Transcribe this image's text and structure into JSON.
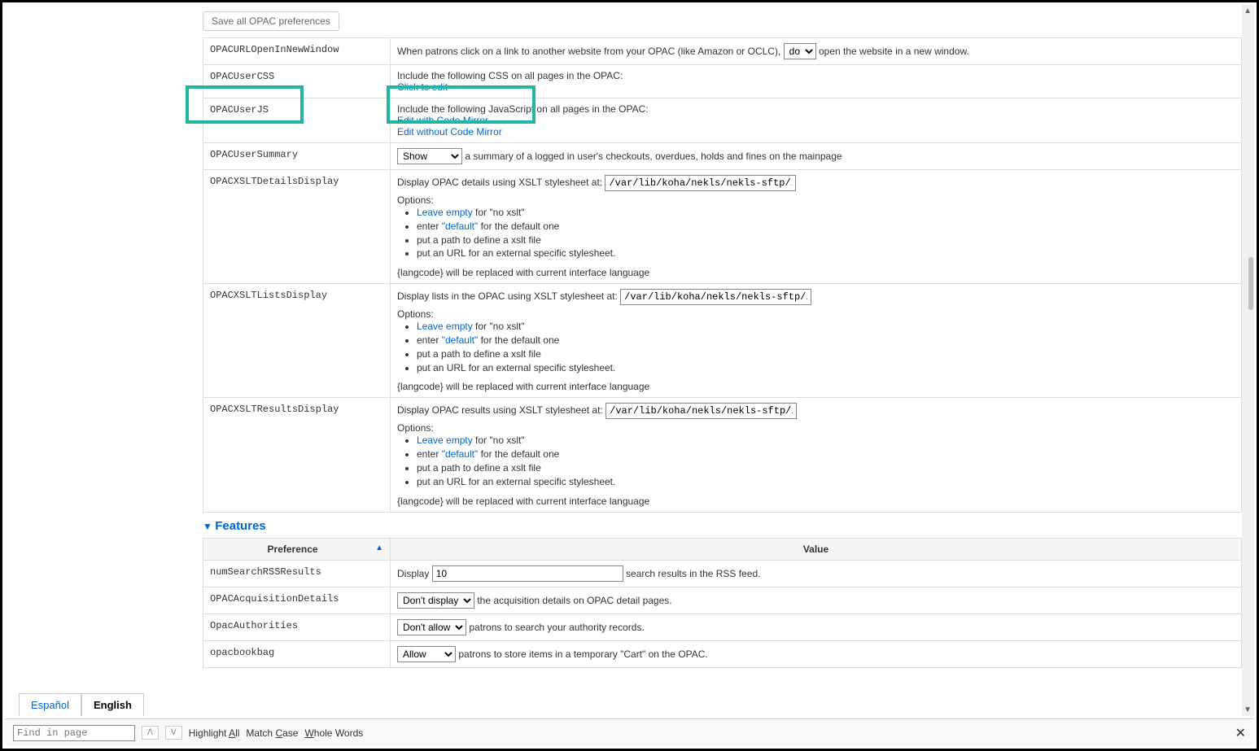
{
  "saveButton": "Save all OPAC preferences",
  "sectionFeatures": "Features",
  "headers": {
    "preference": "Preference",
    "value": "Value"
  },
  "rows": {
    "urlNewWindow": {
      "name": "OPACURLOpenInNewWindow",
      "pre": "When patrons click on a link to another website from your OPAC (like Amazon or OCLC),",
      "sel": "do",
      "post": "open the website in a new window."
    },
    "userCss": {
      "name": "OPACUserCSS",
      "text": "Include the following CSS on all pages in the OPAC:",
      "link": "Click to edit"
    },
    "userJs": {
      "name": "OPACUserJS",
      "text": "Include the following JavaScript on all pages in the OPAC:",
      "link1": "Edit with Code Mirror",
      "link2": "Edit without Code Mirror"
    },
    "userSummary": {
      "name": "OPACUserSummary",
      "sel": "Show",
      "post": "a summary of a logged in user's checkouts, overdues, holds and fines on the mainpage"
    },
    "xsltDetails": {
      "name": "OPACXSLTDetailsDisplay",
      "pre": "Display OPAC details using XSLT stylesheet at:",
      "val": "/var/lib/koha/nekls/nekls-sftp/i"
    },
    "xsltLists": {
      "name": "OPACXSLTListsDisplay",
      "pre": "Display lists in the OPAC using XSLT stylesheet at:",
      "val": "/var/lib/koha/nekls/nekls-sftp/i"
    },
    "xsltResults": {
      "name": "OPACXSLTResultsDisplay",
      "pre": "Display OPAC results using XSLT stylesheet at:",
      "val": "/var/lib/koha/nekls/nekls-sftp/i"
    },
    "numRss": {
      "name": "numSearchRSSResults",
      "pre": "Display",
      "val": "10",
      "post": "search results in the RSS feed."
    },
    "acqDetails": {
      "name": "OPACAcquisitionDetails",
      "sel": "Don't display",
      "post": "the acquisition details on OPAC detail pages."
    },
    "authorities": {
      "name": "OpacAuthorities",
      "sel": "Don't allow",
      "post": "patrons to search your authority records."
    },
    "bookbag": {
      "name": "opacbookbag",
      "sel": "Allow",
      "post": "patrons to store items in a temporary \"Cart\" on the OPAC."
    }
  },
  "xsltOptions": {
    "label": "Options:",
    "leaveEmpty": "Leave empty",
    "leaveEmptyPost": " for \"no xslt\"",
    "enterPre": "enter ",
    "default": "\"default\"",
    "defaultPost": " for the default one",
    "path": "put a path to define a xslt file",
    "url": "put an URL for an external specific stylesheet.",
    "langcode": "{langcode} will be replaced with current interface language"
  },
  "langs": {
    "es": "Español",
    "en": "English"
  },
  "findBar": {
    "placeholder": "Find in page",
    "highlight": "Highlight All",
    "matchCase": "Match Case",
    "wholeWords": "Whole Words"
  }
}
